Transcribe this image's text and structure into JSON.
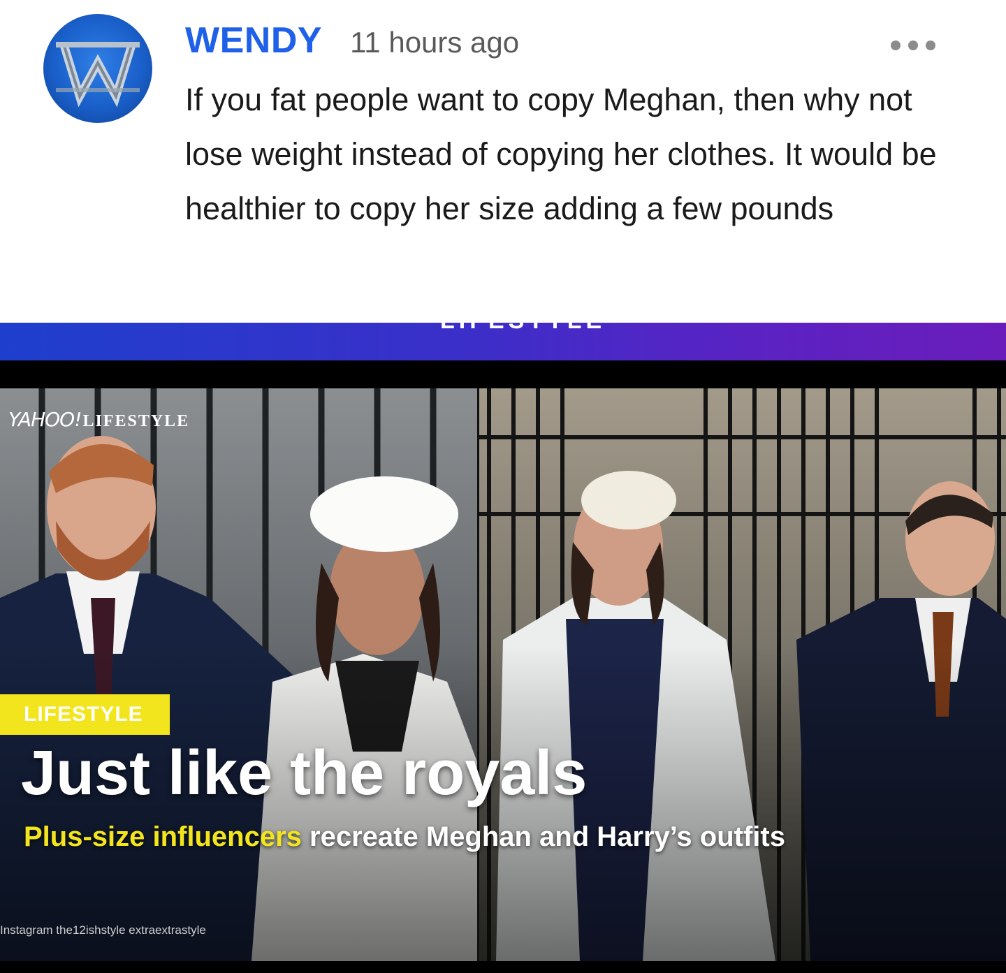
{
  "comment": {
    "author": "WENDY",
    "time": "11 hours ago",
    "text": "If you fat people want to copy Meghan, then why not lose weight instead of copying her clothes. It would be healthier to copy her size adding a few pounds",
    "avatar_letter": "W"
  },
  "header_bar": {
    "label": "LIFESTYLE"
  },
  "article": {
    "brand_yahoo": "YAHOO!",
    "brand_section": "LIFESTYLE",
    "category_badge": "LIFESTYLE",
    "headline": "Just like the royals",
    "subhead_highlight": "Plus-size influencers",
    "subhead_rest": " recreate Meghan and Harry’s outfits",
    "credit": "Instagram the12ishstyle extraextrastyle"
  },
  "colors": {
    "author": "#1e60e8",
    "badge": "#f3e51d",
    "bar_start": "#1e3fcd",
    "bar_end": "#6a1dbb"
  }
}
